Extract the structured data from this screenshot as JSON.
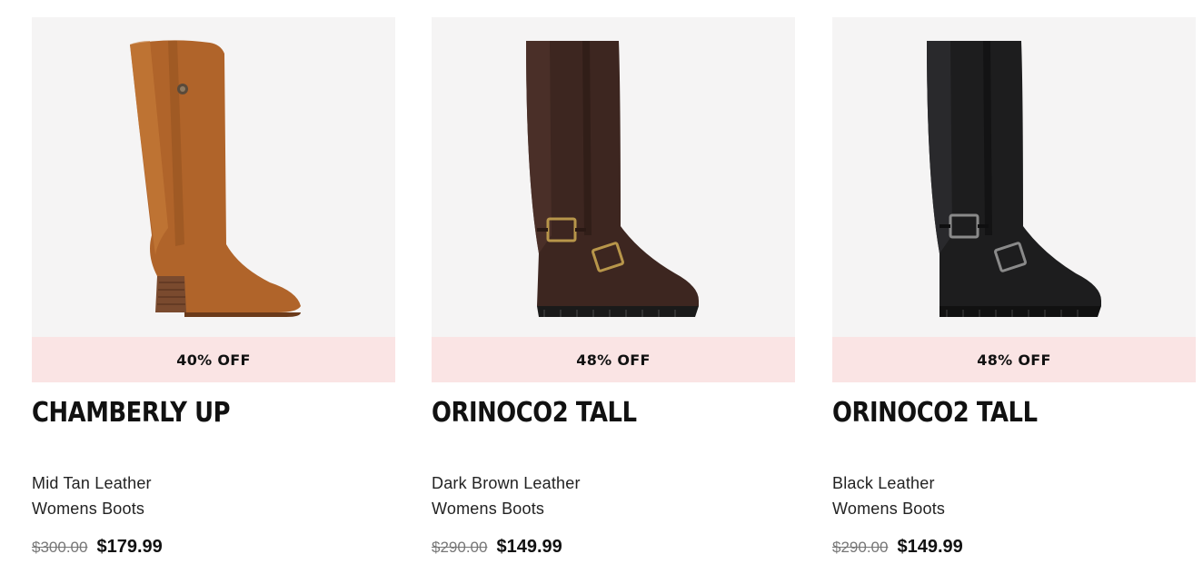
{
  "products": [
    {
      "badge": "40% OFF",
      "name": "CHAMBERLY UP",
      "color": "Mid Tan Leather",
      "category": "Womens Boots",
      "was_price": "$300.00",
      "sale_price": "$179.99",
      "image_icon": "boot-image",
      "boot_color": "#b0642a"
    },
    {
      "badge": "48% OFF",
      "name": "ORINOCO2 TALL",
      "color": "Dark Brown Leather",
      "category": "Womens Boots",
      "was_price": "$290.00",
      "sale_price": "$149.99",
      "image_icon": "boot-image",
      "boot_color": "#3d2620"
    },
    {
      "badge": "48% OFF",
      "name": "ORINOCO2 TALL",
      "color": "Black Leather",
      "category": "Womens Boots",
      "was_price": "$290.00",
      "sale_price": "$149.99",
      "image_icon": "boot-image",
      "boot_color": "#1d1d1e"
    }
  ],
  "colors": {
    "badge_bg": "#fae4e4",
    "image_bg": "#f5f4f4"
  }
}
